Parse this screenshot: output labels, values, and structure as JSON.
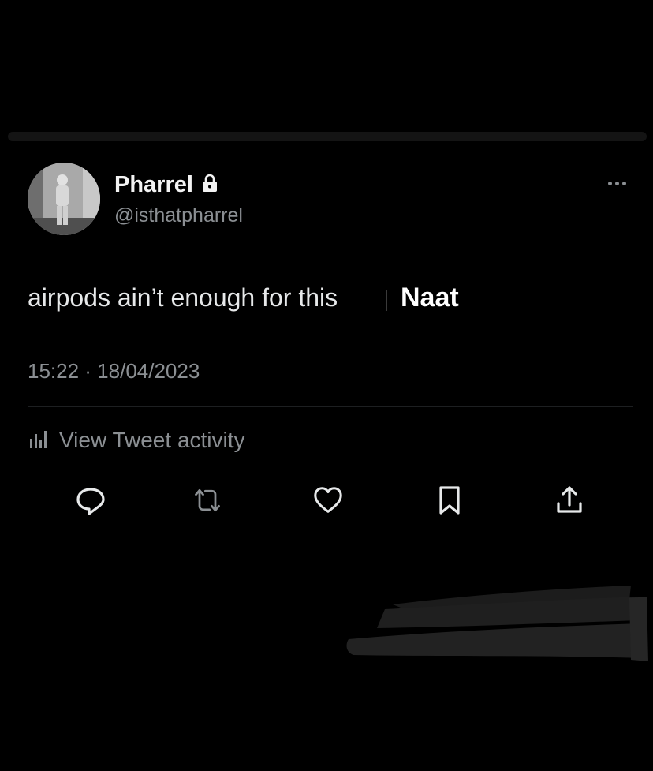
{
  "tweet": {
    "display_name": "Pharrel",
    "handle": "@isthatpharrel",
    "text": "airpods ain’t enough for this",
    "overlay_text": "Naat",
    "timestamp": "15:22 · 18/04/2023",
    "activity_label": "View Tweet activity"
  },
  "icons": {
    "verified_lock": "lock-icon",
    "more": "more-icon",
    "activity": "bar-chart-icon",
    "reply": "reply-icon",
    "retweet": "retweet-icon",
    "like": "heart-icon",
    "bookmark": "bookmark-icon",
    "share": "share-icon"
  },
  "colors": {
    "background": "#000000",
    "primary_text": "#e7e9ea",
    "secondary_text": "#8b8f93",
    "divider": "#1d1f21"
  }
}
